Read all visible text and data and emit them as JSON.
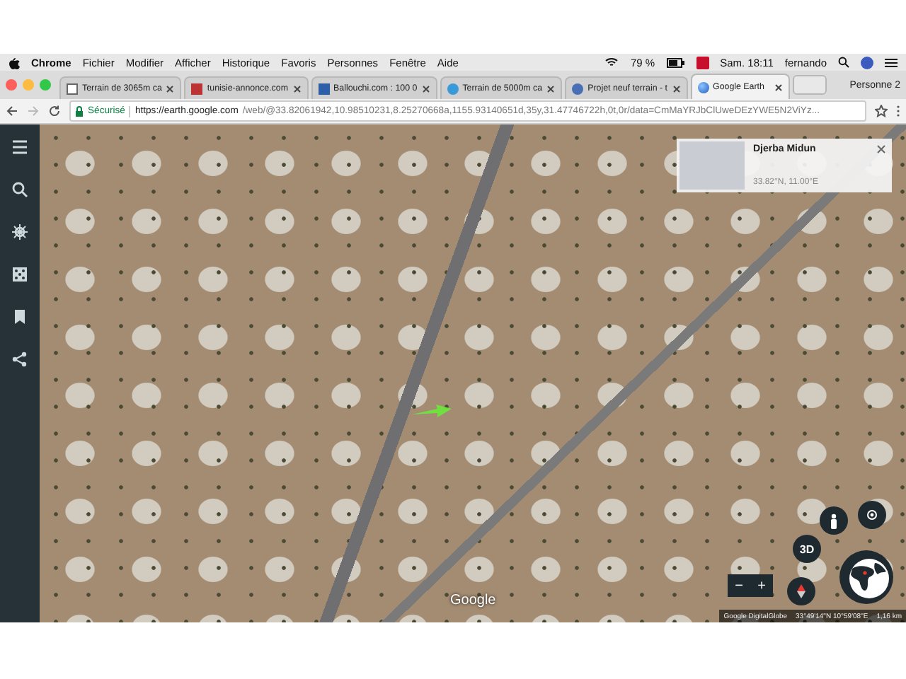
{
  "menu_bar": {
    "app": "Chrome",
    "items": [
      "Fichier",
      "Modifier",
      "Afficher",
      "Historique",
      "Favoris",
      "Personnes",
      "Fenêtre",
      "Aide"
    ],
    "battery": "79 %",
    "clock": "Sam. 18:11",
    "user": "fernando"
  },
  "tabs": [
    {
      "label": "Terrain de 3065m ca",
      "selected": false
    },
    {
      "label": "tunisie-annonce.com",
      "selected": false
    },
    {
      "label": "Ballouchi.com : 100 0",
      "selected": false
    },
    {
      "label": "Terrain de 5000m ca",
      "selected": false
    },
    {
      "label": "Projet neuf terrain - t",
      "selected": false
    },
    {
      "label": "Google Earth",
      "selected": true
    }
  ],
  "profile": "Personne 2",
  "address_bar": {
    "secure_label": "Sécurisé",
    "host": "https://earth.google.com",
    "path": "/web/@33.82061942,10.98510231,8.25270668a,1155.93140651d,35y,31.47746722h,0t,0r/data=CmMaYRJbClUweDEzYWE5N2ViYz..."
  },
  "place_card": {
    "title": "Djerba Midun",
    "coordinates": "33.82°N, 11.00°E"
  },
  "map_controls": {
    "three_d": "3D",
    "zoom_out": "−",
    "zoom_in": "+"
  },
  "logo": "Google",
  "attribution": {
    "credits": "Google  DigitalGlobe",
    "position": "33°49'14\"N 10°59'08\"E",
    "scale": "1,16 km"
  }
}
